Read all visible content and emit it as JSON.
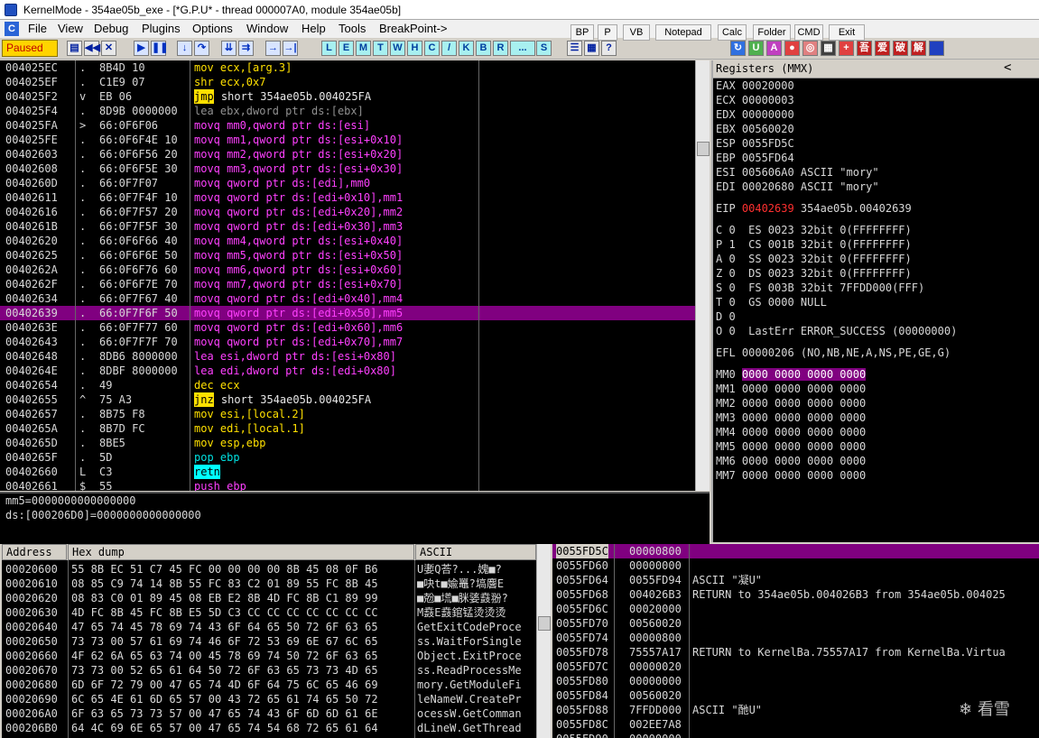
{
  "title": "KernelMode - 354ae05b_exe - [*G.P.U* - thread 000007A0, module 354ae05b]",
  "menu": {
    "icon": "C",
    "items": [
      "File",
      "View",
      "Debug",
      "Plugins",
      "Options",
      "Window",
      "Help",
      "Tools",
      "BreakPoint->"
    ]
  },
  "toptools": [
    "BP",
    "P",
    "VB",
    "Notepad",
    "Calc",
    "Folder",
    "CMD",
    "Exit"
  ],
  "status": "Paused",
  "letters": [
    "L",
    "E",
    "M",
    "T",
    "W",
    "H",
    "C",
    "/",
    "K",
    "B",
    "R",
    "...",
    "S"
  ],
  "disasm": [
    {
      "a": "004025EC",
      "m": ".",
      "h": "8B4D 10",
      "i": "mov ecx,[arg.3]",
      "c": "c-y"
    },
    {
      "a": "004025EF",
      "m": ".",
      "h": "C1E9 07",
      "i": "shr ecx,0x7",
      "c": "c-y"
    },
    {
      "a": "004025F2",
      "m": "v",
      "h": "EB 06",
      "i": "jmp short 354ae05b.004025FA",
      "c": "jmp"
    },
    {
      "a": "004025F4",
      "m": ".",
      "h": "8D9B 0000000",
      "i": "lea ebx,dword ptr ds:[ebx]",
      "c": "c-g"
    },
    {
      "a": "004025FA",
      "m": ">",
      "h": "66:0F6F06",
      "i": "movq mm0,qword ptr ds:[esi]",
      "c": "c-m"
    },
    {
      "a": "004025FE",
      "m": ".",
      "h": "66:0F6F4E 10",
      "i": "movq mm1,qword ptr ds:[esi+0x10]",
      "c": "c-m"
    },
    {
      "a": "00402603",
      "m": ".",
      "h": "66:0F6F56 20",
      "i": "movq mm2,qword ptr ds:[esi+0x20]",
      "c": "c-m"
    },
    {
      "a": "00402608",
      "m": ".",
      "h": "66:0F6F5E 30",
      "i": "movq mm3,qword ptr ds:[esi+0x30]",
      "c": "c-m"
    },
    {
      "a": "0040260D",
      "m": ".",
      "h": "66:0F7F07",
      "i": "movq qword ptr ds:[edi],mm0",
      "c": "c-m"
    },
    {
      "a": "00402611",
      "m": ".",
      "h": "66:0F7F4F 10",
      "i": "movq qword ptr ds:[edi+0x10],mm1",
      "c": "c-m"
    },
    {
      "a": "00402616",
      "m": ".",
      "h": "66:0F7F57 20",
      "i": "movq qword ptr ds:[edi+0x20],mm2",
      "c": "c-m"
    },
    {
      "a": "0040261B",
      "m": ".",
      "h": "66:0F7F5F 30",
      "i": "movq qword ptr ds:[edi+0x30],mm3",
      "c": "c-m"
    },
    {
      "a": "00402620",
      "m": ".",
      "h": "66:0F6F66 40",
      "i": "movq mm4,qword ptr ds:[esi+0x40]",
      "c": "c-m"
    },
    {
      "a": "00402625",
      "m": ".",
      "h": "66:0F6F6E 50",
      "i": "movq mm5,qword ptr ds:[esi+0x50]",
      "c": "c-m"
    },
    {
      "a": "0040262A",
      "m": ".",
      "h": "66:0F6F76 60",
      "i": "movq mm6,qword ptr ds:[esi+0x60]",
      "c": "c-m"
    },
    {
      "a": "0040262F",
      "m": ".",
      "h": "66:0F6F7E 70",
      "i": "movq mm7,qword ptr ds:[esi+0x70]",
      "c": "c-m"
    },
    {
      "a": "00402634",
      "m": ".",
      "h": "66:0F7F67 40",
      "i": "movq qword ptr ds:[edi+0x40],mm4",
      "c": "c-m"
    },
    {
      "a": "00402639",
      "m": ".",
      "h": "66:0F7F6F 50",
      "i": "movq qword ptr ds:[edi+0x50],mm5",
      "c": "c-m"
    },
    {
      "a": "0040263E",
      "m": ".",
      "h": "66:0F7F77 60",
      "i": "movq qword ptr ds:[edi+0x60],mm6",
      "c": "c-m"
    },
    {
      "a": "00402643",
      "m": ".",
      "h": "66:0F7F7F 70",
      "i": "movq qword ptr ds:[edi+0x70],mm7",
      "c": "c-m"
    },
    {
      "a": "00402648",
      "m": ".",
      "h": "8DB6 8000000",
      "i": "lea esi,dword ptr ds:[esi+0x80]",
      "c": "c-m"
    },
    {
      "a": "0040264E",
      "m": ".",
      "h": "8DBF 8000000",
      "i": "lea edi,dword ptr ds:[edi+0x80]",
      "c": "c-m"
    },
    {
      "a": "00402654",
      "m": ".",
      "h": "49",
      "i": "dec ecx",
      "c": "c-y"
    },
    {
      "a": "00402655",
      "m": "^",
      "h": "75 A3",
      "i": "jnz short 354ae05b.004025FA",
      "c": "jnz"
    },
    {
      "a": "00402657",
      "m": ".",
      "h": "8B75 F8",
      "i": "mov esi,[local.2]",
      "c": "c-y"
    },
    {
      "a": "0040265A",
      "m": ".",
      "h": "8B7D FC",
      "i": "mov edi,[local.1]",
      "c": "c-y"
    },
    {
      "a": "0040265D",
      "m": ".",
      "h": "8BE5",
      "i": "mov esp,ebp",
      "c": "c-y"
    },
    {
      "a": "0040265F",
      "m": ".",
      "h": "5D",
      "i": "pop ebp",
      "c": "pop"
    },
    {
      "a": "00402660",
      "m": "L",
      "h": "C3",
      "i": "retn",
      "c": "retn"
    },
    {
      "a": "00402661",
      "m": "$",
      "h": "55",
      "i": "push ebp",
      "c": "c-m"
    }
  ],
  "selected_row": 17,
  "registers": {
    "header": "Registers (MMX)",
    "gp": [
      "EAX 00020000",
      "ECX 00000003",
      "EDX 00000000",
      "EBX 00560020",
      "ESP 0055FD5C",
      "EBP 0055FD64",
      "ESI 005606A0 ASCII \"mory\"",
      "EDI 00020680 ASCII \"mory\""
    ],
    "eip_label": "EIP",
    "eip_value": "00402639",
    "eip_desc": "354ae05b.00402639",
    "flags": [
      "C 0  ES 0023 32bit 0(FFFFFFFF)",
      "P 1  CS 001B 32bit 0(FFFFFFFF)",
      "A 0  SS 0023 32bit 0(FFFFFFFF)",
      "Z 0  DS 0023 32bit 0(FFFFFFFF)",
      "S 0  FS 003B 32bit 7FFDD000(FFF)",
      "T 0  GS 0000 NULL",
      "D 0",
      "O 0  LastErr ERROR_SUCCESS (00000000)"
    ],
    "efl": "EFL 00000206 (NO,NB,NE,A,NS,PE,GE,G)",
    "mm": [
      "MM0",
      "MM1",
      "MM2",
      "MM3",
      "MM4",
      "MM5",
      "MM6",
      "MM7"
    ],
    "mm_value": "0000 0000 0000 0000"
  },
  "info": [
    "mm5=0000000000000000",
    "ds:[000206D0]=0000000000000000"
  ],
  "dump": {
    "headers": [
      "Address",
      "Hex dump",
      "ASCII"
    ],
    "rows": [
      [
        "00020600",
        "55 8B EC 51 C7 45 FC 00 00 00 00 8B 45 08 0F B6",
        "U嬱Q荅?...媿■?"
      ],
      [
        "00020610",
        "08 85 C9 74 14 8B 55 FC 83 C2 01 89 55 FC 8B 45",
        "■吷t■婾鼉?塙麐E"
      ],
      [
        "00020620",
        "08 83 C0 01 89 45 08 EB E2 8B 4D FC 8B C1 89 99",
        "■兝■塃■脒婱鼖翂?"
      ],
      [
        "00020630",
        "4D FC 8B 45 FC 8B E5 5D C3 CC CC CC CC CC CC CC",
        "M鼖E鼖錧锰烫烫烫"
      ],
      [
        "00020640",
        "47 65 74 45 78 69 74 43 6F 64 65 50 72 6F 63 65",
        "GetExitCodeProce"
      ],
      [
        "00020650",
        "73 73 00 57 61 69 74 46 6F 72 53 69 6E 67 6C 65",
        "ss.WaitForSingle"
      ],
      [
        "00020660",
        "4F 62 6A 65 63 74 00 45 78 69 74 50 72 6F 63 65",
        "Object.ExitProce"
      ],
      [
        "00020670",
        "73 73 00 52 65 61 64 50 72 6F 63 65 73 73 4D 65",
        "ss.ReadProcessMe"
      ],
      [
        "00020680",
        "6D 6F 72 79 00 47 65 74 4D 6F 64 75 6C 65 46 69",
        "mory.GetModuleFi"
      ],
      [
        "00020690",
        "6C 65 4E 61 6D 65 57 00 43 72 65 61 74 65 50 72",
        "leNameW.CreatePr"
      ],
      [
        "000206A0",
        "6F 63 65 73 73 57 00 47 65 74 43 6F 6D 6D 61 6E",
        "ocessW.GetComman"
      ],
      [
        "000206B0",
        "64 4C 69 6E 65 57 00 47 65 74 54 68 72 65 61 64",
        "dLineW.GetThread"
      ]
    ]
  },
  "stack": {
    "rows": [
      [
        "0055FD5C",
        "00000800",
        ""
      ],
      [
        "0055FD60",
        "00000000",
        ""
      ],
      [
        "0055FD64",
        "0055FD94",
        "ASCII \"凝U\""
      ],
      [
        "0055FD68",
        "004026B3",
        "RETURN to 354ae05b.004026B3 from 354ae05b.004025"
      ],
      [
        "0055FD6C",
        "00020000",
        ""
      ],
      [
        "0055FD70",
        "00560020",
        ""
      ],
      [
        "0055FD74",
        "00000800",
        ""
      ],
      [
        "0055FD78",
        "75557A17",
        "RETURN to KernelBa.75557A17 from KernelBa.Virtua"
      ],
      [
        "0055FD7C",
        "00000020",
        ""
      ],
      [
        "0055FD80",
        "00000000",
        ""
      ],
      [
        "0055FD84",
        "00560020",
        ""
      ],
      [
        "0055FD88",
        "7FFDD000",
        "ASCII \"酏U\""
      ],
      [
        "0055FD8C",
        "002EE7A8",
        ""
      ],
      [
        "0055FD90",
        "00000000",
        ""
      ]
    ]
  },
  "watermark": "看雪"
}
